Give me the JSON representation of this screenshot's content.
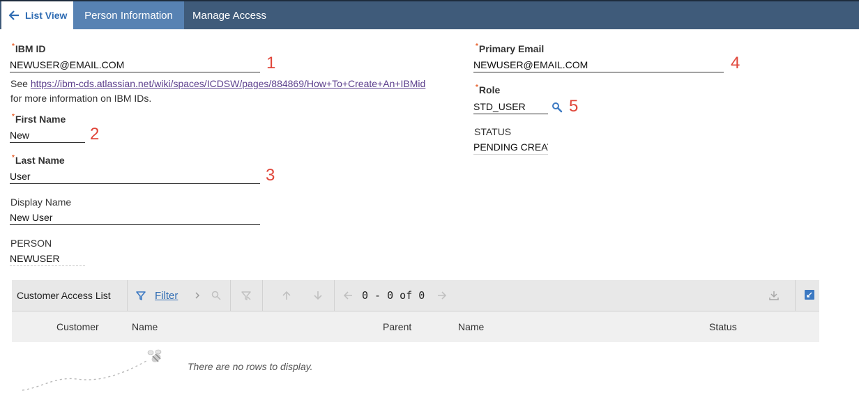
{
  "tabs": {
    "list_view": "List View",
    "person_information": "Person Information",
    "manage_access": "Manage Access"
  },
  "fields": {
    "ibm_id": {
      "label": "IBM ID",
      "value": "NEWUSER@EMAIL.COM"
    },
    "ibm_id_help": {
      "prefix": "See ",
      "link": "https://ibm-cds.atlassian.net/wiki/spaces/ICDSW/pages/884869/How+To+Create+An+IBMid",
      "suffix": "for more information on IBM IDs."
    },
    "first_name": {
      "label": "First Name",
      "value": "New"
    },
    "last_name": {
      "label": "Last Name",
      "value": "User"
    },
    "display_name": {
      "label": "Display Name",
      "value": "New User"
    },
    "person": {
      "label": "PERSON",
      "value": "NEWUSER"
    },
    "primary_email": {
      "label": "Primary Email",
      "value": "NEWUSER@EMAIL.COM"
    },
    "role": {
      "label": "Role",
      "value": "STD_USER"
    },
    "status": {
      "label": "STATUS",
      "value": "PENDING CREAT"
    }
  },
  "annotations": [
    "1",
    "2",
    "3",
    "4",
    "5"
  ],
  "table": {
    "title": "Customer Access List",
    "filter_label": "Filter",
    "pager": "0 - 0 of 0",
    "columns": [
      "Customer",
      "Name",
      "Parent",
      "Name",
      "Status"
    ],
    "empty_message": "There are no rows to display."
  },
  "colors": {
    "tab_bar": "#3f5b7a",
    "active_tab": "#5782b3",
    "required_star": "#e8612c",
    "annotation": "#e0463a",
    "link": "#5b3e8c"
  }
}
